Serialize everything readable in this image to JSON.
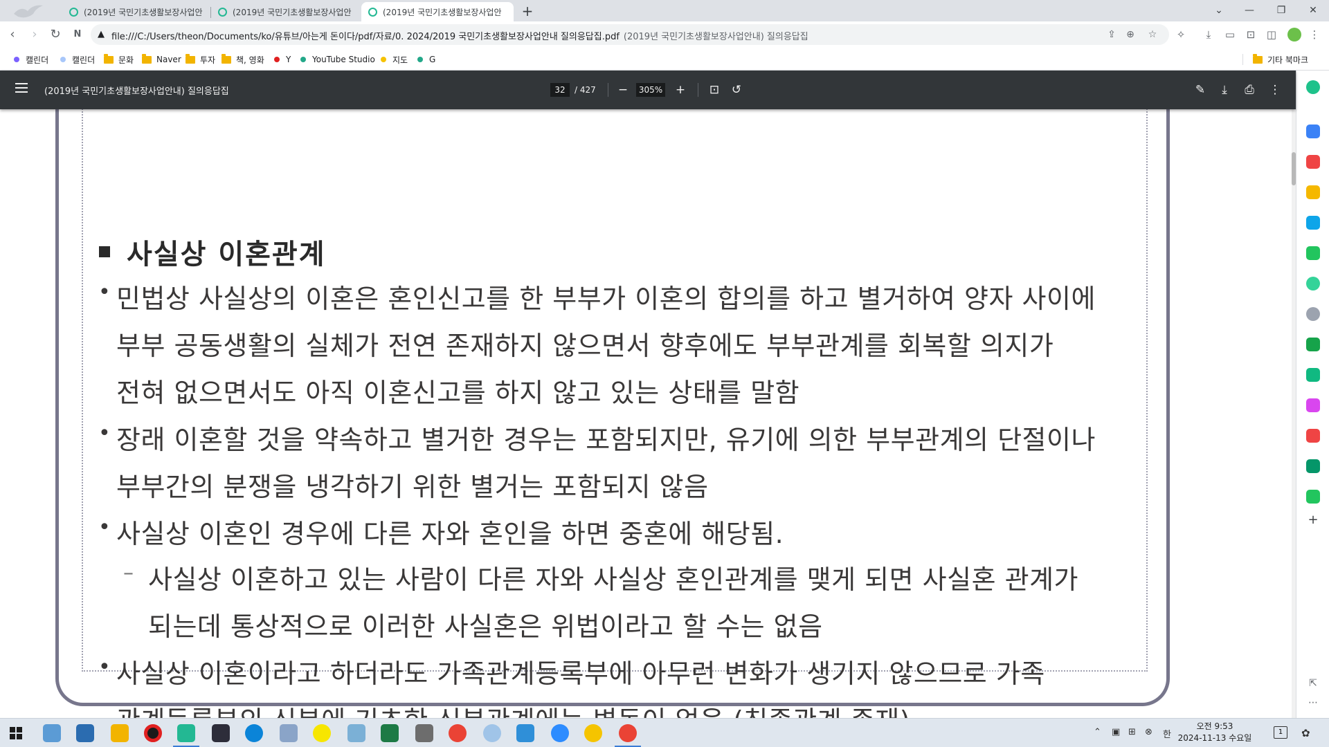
{
  "browser": {
    "tabs": [
      {
        "title": "(2019년 국민기초생활보장사업안"
      },
      {
        "title": "(2019년 국민기초생활보장사업안"
      },
      {
        "title": "(2019년 국민기초생활보장사업안"
      }
    ],
    "new_tab_label": "+",
    "window_controls": {
      "tab_search": "⌄",
      "minimize": "—",
      "restore": "❐",
      "close": "✕"
    },
    "url": "file:///C:/Users/theon/Documents/ko/유튜브/아는게 돈이다/pdf/자료/0. 2024/2019 국민기초생활보장사업안내 질의응답집.pdf",
    "url_suffix": "(2019년 국민기초생활보장사업안내) 질의응답집",
    "bookmarks": [
      {
        "label": "캘린더",
        "kind": "dot",
        "color": "#7b61ff"
      },
      {
        "label": "캘린더",
        "kind": "dot",
        "color": "#a8c7fa"
      },
      {
        "label": "문화",
        "kind": "folder"
      },
      {
        "label": "Naver",
        "kind": "folder"
      },
      {
        "label": "투자",
        "kind": "folder"
      },
      {
        "label": "책, 영화",
        "kind": "folder"
      },
      {
        "label": "Y",
        "kind": "dot",
        "color": "#e02020"
      },
      {
        "label": "YouTube Studio",
        "kind": "dot",
        "color": "#23a889"
      },
      {
        "label": "지도",
        "kind": "dot",
        "color": "#f6c200"
      },
      {
        "label": "G",
        "kind": "dot",
        "color": "#23a889"
      }
    ],
    "other_bookmarks": "기타 북마크"
  },
  "pdf": {
    "title": "(2019년 국민기초생활보장사업안내) 질의응답집",
    "current_page": "32",
    "total_pages": "/ 427",
    "zoom": "305%"
  },
  "document": {
    "heading": "사실상 이혼관계",
    "lines": [
      {
        "bullet": "•",
        "text": "민법상 사실상의 이혼은 혼인신고를 한 부부가 이혼의 합의를 하고 별거하여 양자 사이에"
      },
      {
        "bullet": "",
        "text": "부부 공동생활의 실체가 전연 존재하지 않으면서 향후에도 부부관계를 회복할 의지가"
      },
      {
        "bullet": "",
        "text": "전혀 없으면서도 아직 이혼신고를 하지 않고 있는 상태를 말함"
      },
      {
        "bullet": "•",
        "text": "장래 이혼할 것을 약속하고 별거한 경우는 포함되지만, 유기에 의한 부부관계의 단절이나"
      },
      {
        "bullet": "",
        "text": "부부간의 분쟁을 냉각하기 위한 별거는 포함되지 않음"
      },
      {
        "bullet": "•",
        "text": "사실상 이혼인 경우에 다른 자와 혼인을 하면 중혼에 해당됨."
      },
      {
        "bullet": "–",
        "text": "사실상 이혼하고 있는 사람이 다른 자와 사실상 혼인관계를 맺게 되면 사실혼 관계가"
      },
      {
        "bullet": "",
        "text": "되는데 통상적으로 이러한 사실혼은 위법이라고 할 수는 없음"
      },
      {
        "bullet": "•",
        "text": "사실상 이혼이라고 하더라도 가족관계등록부에 아무런 변화가 생기지 않으므로 가족"
      },
      {
        "bullet": "",
        "text": "관계등록부의 신분에 기초한 신분관계에는 변동이 없음 (친족관계 존재)"
      }
    ]
  },
  "taskbar": {
    "clock_time": "오전 9:53",
    "clock_date": "2024-11-13 수요일",
    "ime": "한",
    "notification_count": "1"
  }
}
